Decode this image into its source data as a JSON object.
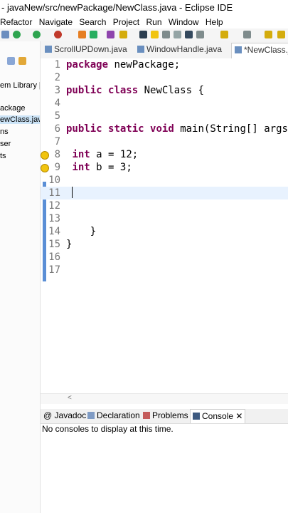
{
  "window": {
    "title": "- javaNew/src/newPackage/NewClass.java - Eclipse IDE"
  },
  "menu": [
    "Refactor",
    "Navigate",
    "Search",
    "Project",
    "Run",
    "Window",
    "Help"
  ],
  "left_pane": {
    "items": [
      "em Library [",
      "ackage",
      "ewClass.java",
      "ns",
      "ser",
      "ts"
    ]
  },
  "editor_tabs": [
    {
      "label": "ScrollUPDown.java"
    },
    {
      "label": "WindowHandle.java"
    },
    {
      "label": "*NewClass.ja"
    }
  ],
  "code": [
    {
      "n": "1",
      "text": "package newPackage;"
    },
    {
      "n": "2",
      "text": ""
    },
    {
      "n": "3",
      "text": "public class NewClass {"
    },
    {
      "n": "4",
      "text": ""
    },
    {
      "n": "5",
      "text": ""
    },
    {
      "n": "6",
      "text": "public static void main(String[] args)"
    },
    {
      "n": "7",
      "text": ""
    },
    {
      "n": "8",
      "text": " int a = 12;"
    },
    {
      "n": "9",
      "text": " int b = 3;"
    },
    {
      "n": "10",
      "text": ""
    },
    {
      "n": "11",
      "text": ""
    },
    {
      "n": "12",
      "text": ""
    },
    {
      "n": "13",
      "text": ""
    },
    {
      "n": "14",
      "text": "    }"
    },
    {
      "n": "15",
      "text": "}"
    },
    {
      "n": "16",
      "text": ""
    },
    {
      "n": "17",
      "text": ""
    }
  ],
  "bottom_tabs": [
    {
      "label": "Javadoc"
    },
    {
      "label": "Declaration"
    },
    {
      "label": "Problems"
    },
    {
      "label": "Console"
    }
  ],
  "console": {
    "message": "No consoles to display at this time."
  }
}
